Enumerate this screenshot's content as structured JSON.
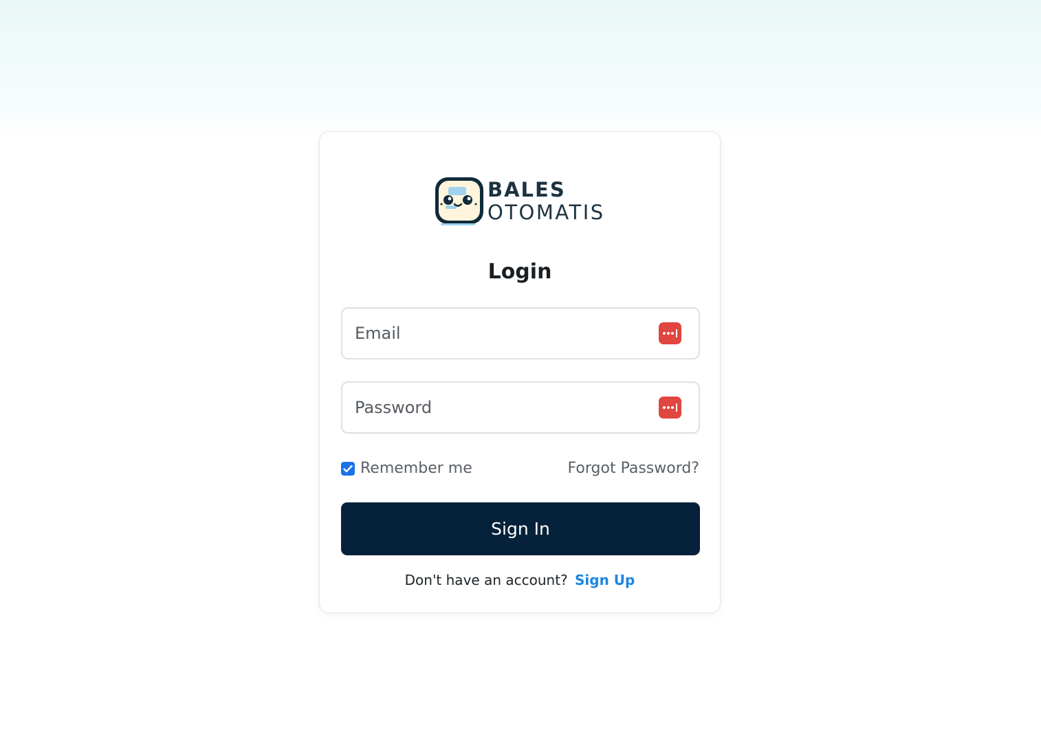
{
  "logo": {
    "line1": "BALES",
    "line2": "OTOMATIS",
    "icon": "robot-face-icon"
  },
  "form": {
    "title": "Login",
    "email": {
      "placeholder": "Email",
      "value": "",
      "icon": "password-manager-icon"
    },
    "password": {
      "placeholder": "Password",
      "value": "",
      "icon": "password-manager-icon"
    },
    "remember_me": {
      "label": "Remember me",
      "checked": true
    },
    "forgot_password": "Forgot Password?",
    "submit_label": "Sign In",
    "signup_prompt": "Don't have an account?",
    "signup_link": "Sign Up"
  },
  "colors": {
    "primary_button": "#05223a",
    "link": "#1a86e6",
    "checkbox": "#1a73e8",
    "password_manager_badge": "#e0453f",
    "background_top": "#eaf8f8"
  }
}
